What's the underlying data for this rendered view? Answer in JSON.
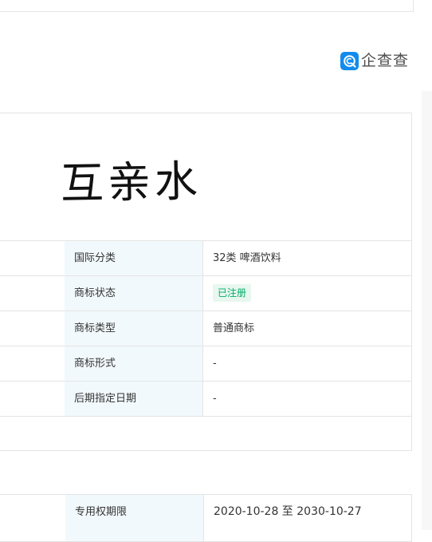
{
  "logo": {
    "text": "企查查",
    "icon": "qichacha-logo-icon",
    "color": "#128bed"
  },
  "trademark": {
    "image_text": "互亲水"
  },
  "details": [
    {
      "label": "国际分类",
      "value": "32类 啤酒饮料"
    },
    {
      "label": "商标状态",
      "value": "已注册",
      "badge_color": "#00ad65"
    },
    {
      "label": "商标类型",
      "value": "普通商标"
    },
    {
      "label": "商标形式",
      "value": "-"
    },
    {
      "label": "后期指定日期",
      "value": "-"
    }
  ],
  "validity": {
    "label": "专用权期限",
    "value": "2020-10-28 至 2030-10-27"
  }
}
